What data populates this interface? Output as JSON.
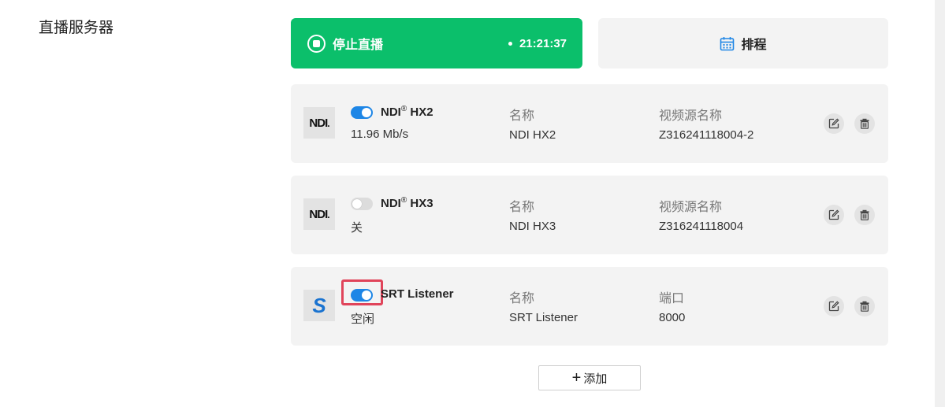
{
  "section": {
    "title": "直播服务器"
  },
  "live": {
    "stop_label": "停止直播",
    "elapsed": "21:21:37"
  },
  "schedule": {
    "label": "排程"
  },
  "servers": [
    {
      "logo_text": "NDI",
      "logo_trail": ".",
      "enabled": true,
      "name": "NDI",
      "name_mark": "®",
      "name_suffix": "HX2",
      "status": "11.96 Mb/s",
      "col1_label": "名称",
      "col1_value": "NDI HX2",
      "col2_label": "视频源名称",
      "col2_value": "Z316241118004-2"
    },
    {
      "logo_text": "NDI",
      "logo_trail": ".",
      "enabled": false,
      "name": "NDI",
      "name_mark": "®",
      "name_suffix": "HX3",
      "status": "关",
      "col1_label": "名称",
      "col1_value": "NDI HX3",
      "col2_label": "视频源名称",
      "col2_value": "Z316241118004"
    },
    {
      "logo_text": "S",
      "enabled": true,
      "name": "SRT Listener",
      "status": "空闲",
      "col1_label": "名称",
      "col1_value": "SRT Listener",
      "col2_label": "端口",
      "col2_value": "8000"
    }
  ],
  "add": {
    "plus": "+",
    "label": "添加"
  },
  "colors": {
    "live_green": "#0bbf6b",
    "toggle_on": "#1e86e6",
    "highlight": "#e0445a"
  }
}
